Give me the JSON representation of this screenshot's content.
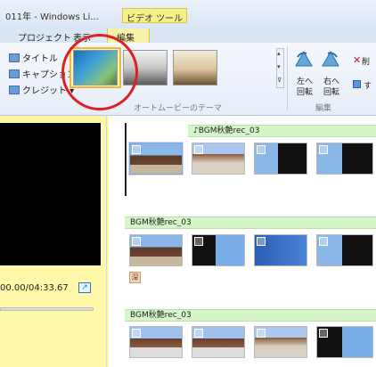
{
  "window": {
    "title": "011年 - Windows Li...",
    "context_tab": "ビデオ ツール"
  },
  "ribbon": {
    "tabs": [
      "プロジェクト",
      "表示",
      "編集"
    ],
    "text_buttons": [
      "タイトル",
      "キャプション",
      "クレジット ▾"
    ],
    "theme_group_label": "オートムービーのテーマ",
    "edit_group_label": "編集",
    "rotate_left": [
      "左へ",
      "回転"
    ],
    "rotate_right": [
      "右へ",
      "回転"
    ],
    "delete_label": "削",
    "select_all_label": "す"
  },
  "preview": {
    "time": "00.00/04:33.67"
  },
  "storyboard": {
    "tracks": [
      "♪BGM秋艶rec_03",
      "BGM秋艶rec_03",
      "BGM秋艶rec_03"
    ],
    "text_badge": "深"
  },
  "icons": {
    "theme_scroll_up": "▴",
    "theme_scroll_down": "▾",
    "theme_expand": "⊽",
    "delete": "✕",
    "fullscreen": "↗"
  },
  "colors": {
    "accent_highlight": "#e02020",
    "music_track": "#d4f6c8",
    "context_tab": "#f7f088"
  }
}
